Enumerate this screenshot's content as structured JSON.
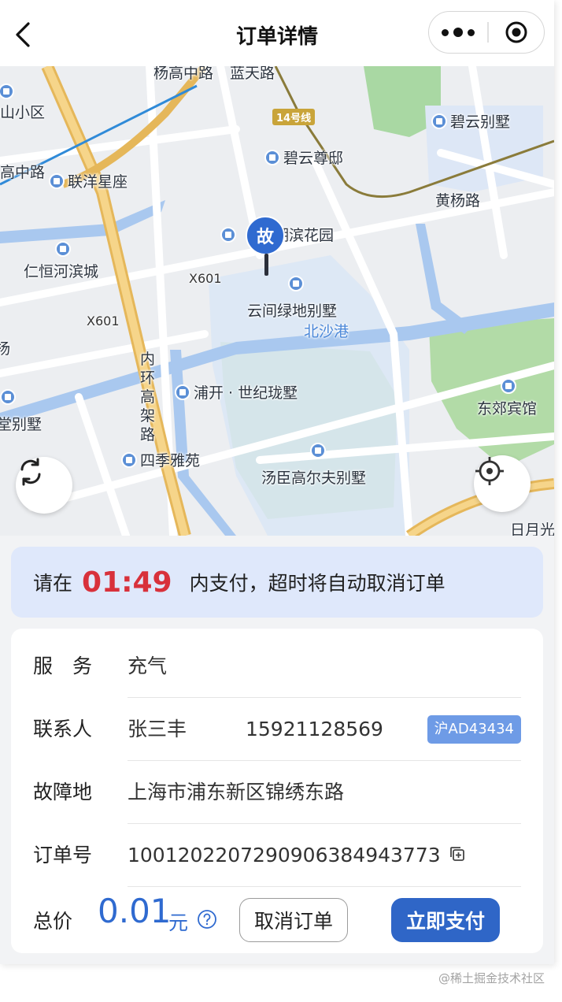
{
  "nav": {
    "title": "订单详情"
  },
  "map": {
    "fault_marker": "故",
    "labels": {
      "yanggao": "杨高中路",
      "lantian": "蓝天路",
      "shanxiaoqu": "山小区",
      "line14": "14号线",
      "biyun_villa": "碧云别墅",
      "biyun_zunyu": "碧云尊邸",
      "gaozhong": "高中路",
      "lianyang": "联洋星座",
      "huangyang": "黄杨路",
      "hubin": "湖滨花园",
      "renheng": "仁恒河滨城",
      "x601a": "X601",
      "x601b": "X601",
      "yunjian": "云间绿地别墅",
      "beisha": "北沙港",
      "yang": "杨",
      "neihuan": "内环高架路",
      "pukai": "浦开 · 世纪珑墅",
      "dongjiao": "东郊宾馆",
      "tangbie": "堂别墅",
      "siji": "四季雅苑",
      "tangchen": "汤臣高尔夫别墅",
      "riyue": "日月光"
    }
  },
  "countdown": {
    "prefix": "请在",
    "time": "01:49",
    "suffix": "内支付，超时将自动取消订单"
  },
  "order": {
    "service_label": "服务",
    "service_value": "充气",
    "contact_label": "联系人",
    "contact_name": "张三丰",
    "contact_phone": "15921128569",
    "plate": "沪AD43434",
    "location_label": "故障地",
    "location_value": "上海市浦东新区锦绣东路",
    "order_no_label": "订单号",
    "order_no_value": "1001202207290906384943773",
    "total_label": "总价",
    "total_amount": "0.01",
    "total_unit": "元",
    "cancel_button": "取消订单",
    "pay_button": "立即支付"
  },
  "watermark": "@稀土掘金技术社区",
  "colors": {
    "primary": "#2f66c7",
    "countdown_red": "#d8313b",
    "banner_bg": "#dfe8fb",
    "plate_bg": "#6e9be6"
  }
}
